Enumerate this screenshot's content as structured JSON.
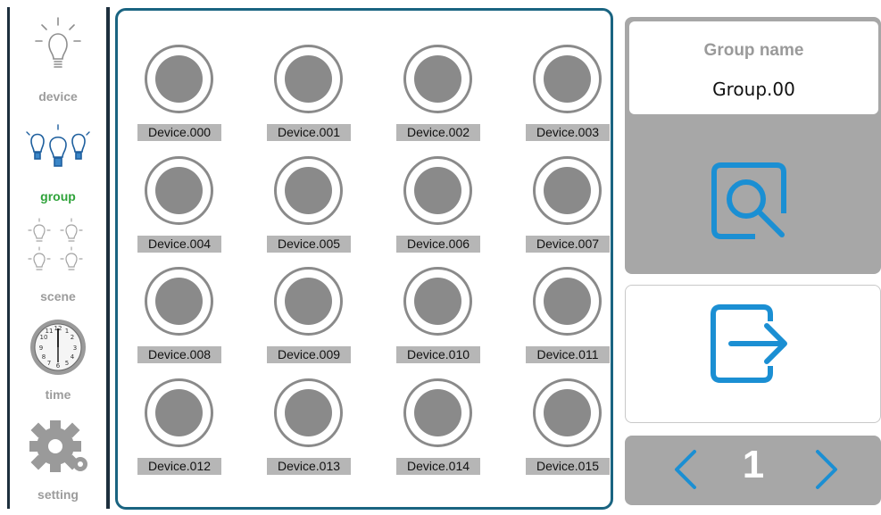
{
  "nav": {
    "items": [
      {
        "label": "device",
        "icon": "bulb-icon",
        "active": false
      },
      {
        "label": "group",
        "icon": "bulbs-group-icon",
        "active": true
      },
      {
        "label": "scene",
        "icon": "scene-bulbs-icon",
        "active": false
      },
      {
        "label": "time",
        "icon": "clock-icon",
        "active": false
      },
      {
        "label": "setting",
        "icon": "gear-icon",
        "active": false
      }
    ]
  },
  "devices": [
    "Device.000",
    "Device.001",
    "Device.002",
    "Device.003",
    "Device.004",
    "Device.005",
    "Device.006",
    "Device.007",
    "Device.008",
    "Device.009",
    "Device.010",
    "Device.011",
    "Device.012",
    "Device.013",
    "Device.014",
    "Device.015"
  ],
  "group": {
    "title": "Group name",
    "value": "Group.00"
  },
  "pager": {
    "page": "1"
  },
  "colors": {
    "accent": "#1b8fd3",
    "active_nav": "#2fa33a",
    "panel_border": "#1a6481",
    "gray_panel": "#a7a7a7"
  }
}
